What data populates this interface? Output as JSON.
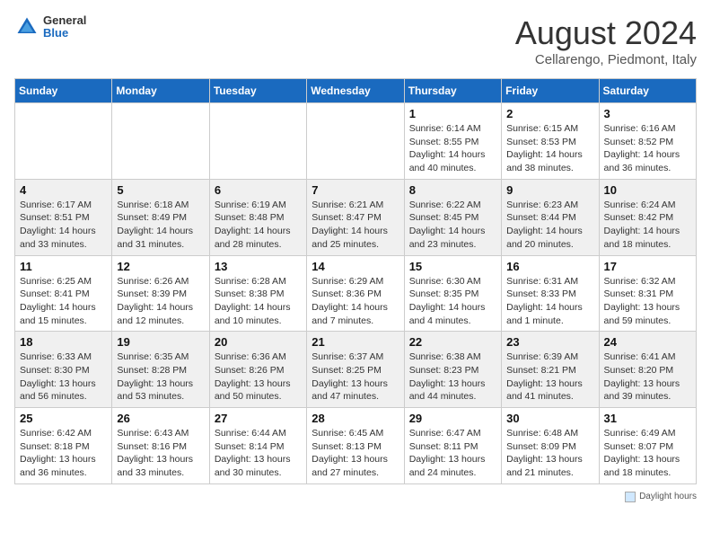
{
  "header": {
    "logo_general": "General",
    "logo_blue": "Blue",
    "month_title": "August 2024",
    "location": "Cellarengo, Piedmont, Italy"
  },
  "weekdays": [
    "Sunday",
    "Monday",
    "Tuesday",
    "Wednesday",
    "Thursday",
    "Friday",
    "Saturday"
  ],
  "weeks": [
    [
      {
        "day": "",
        "info": ""
      },
      {
        "day": "",
        "info": ""
      },
      {
        "day": "",
        "info": ""
      },
      {
        "day": "",
        "info": ""
      },
      {
        "day": "1",
        "info": "Sunrise: 6:14 AM\nSunset: 8:55 PM\nDaylight: 14 hours\nand 40 minutes."
      },
      {
        "day": "2",
        "info": "Sunrise: 6:15 AM\nSunset: 8:53 PM\nDaylight: 14 hours\nand 38 minutes."
      },
      {
        "day": "3",
        "info": "Sunrise: 6:16 AM\nSunset: 8:52 PM\nDaylight: 14 hours\nand 36 minutes."
      }
    ],
    [
      {
        "day": "4",
        "info": "Sunrise: 6:17 AM\nSunset: 8:51 PM\nDaylight: 14 hours\nand 33 minutes."
      },
      {
        "day": "5",
        "info": "Sunrise: 6:18 AM\nSunset: 8:49 PM\nDaylight: 14 hours\nand 31 minutes."
      },
      {
        "day": "6",
        "info": "Sunrise: 6:19 AM\nSunset: 8:48 PM\nDaylight: 14 hours\nand 28 minutes."
      },
      {
        "day": "7",
        "info": "Sunrise: 6:21 AM\nSunset: 8:47 PM\nDaylight: 14 hours\nand 25 minutes."
      },
      {
        "day": "8",
        "info": "Sunrise: 6:22 AM\nSunset: 8:45 PM\nDaylight: 14 hours\nand 23 minutes."
      },
      {
        "day": "9",
        "info": "Sunrise: 6:23 AM\nSunset: 8:44 PM\nDaylight: 14 hours\nand 20 minutes."
      },
      {
        "day": "10",
        "info": "Sunrise: 6:24 AM\nSunset: 8:42 PM\nDaylight: 14 hours\nand 18 minutes."
      }
    ],
    [
      {
        "day": "11",
        "info": "Sunrise: 6:25 AM\nSunset: 8:41 PM\nDaylight: 14 hours\nand 15 minutes."
      },
      {
        "day": "12",
        "info": "Sunrise: 6:26 AM\nSunset: 8:39 PM\nDaylight: 14 hours\nand 12 minutes."
      },
      {
        "day": "13",
        "info": "Sunrise: 6:28 AM\nSunset: 8:38 PM\nDaylight: 14 hours\nand 10 minutes."
      },
      {
        "day": "14",
        "info": "Sunrise: 6:29 AM\nSunset: 8:36 PM\nDaylight: 14 hours\nand 7 minutes."
      },
      {
        "day": "15",
        "info": "Sunrise: 6:30 AM\nSunset: 8:35 PM\nDaylight: 14 hours\nand 4 minutes."
      },
      {
        "day": "16",
        "info": "Sunrise: 6:31 AM\nSunset: 8:33 PM\nDaylight: 14 hours\nand 1 minute."
      },
      {
        "day": "17",
        "info": "Sunrise: 6:32 AM\nSunset: 8:31 PM\nDaylight: 13 hours\nand 59 minutes."
      }
    ],
    [
      {
        "day": "18",
        "info": "Sunrise: 6:33 AM\nSunset: 8:30 PM\nDaylight: 13 hours\nand 56 minutes."
      },
      {
        "day": "19",
        "info": "Sunrise: 6:35 AM\nSunset: 8:28 PM\nDaylight: 13 hours\nand 53 minutes."
      },
      {
        "day": "20",
        "info": "Sunrise: 6:36 AM\nSunset: 8:26 PM\nDaylight: 13 hours\nand 50 minutes."
      },
      {
        "day": "21",
        "info": "Sunrise: 6:37 AM\nSunset: 8:25 PM\nDaylight: 13 hours\nand 47 minutes."
      },
      {
        "day": "22",
        "info": "Sunrise: 6:38 AM\nSunset: 8:23 PM\nDaylight: 13 hours\nand 44 minutes."
      },
      {
        "day": "23",
        "info": "Sunrise: 6:39 AM\nSunset: 8:21 PM\nDaylight: 13 hours\nand 41 minutes."
      },
      {
        "day": "24",
        "info": "Sunrise: 6:41 AM\nSunset: 8:20 PM\nDaylight: 13 hours\nand 39 minutes."
      }
    ],
    [
      {
        "day": "25",
        "info": "Sunrise: 6:42 AM\nSunset: 8:18 PM\nDaylight: 13 hours\nand 36 minutes."
      },
      {
        "day": "26",
        "info": "Sunrise: 6:43 AM\nSunset: 8:16 PM\nDaylight: 13 hours\nand 33 minutes."
      },
      {
        "day": "27",
        "info": "Sunrise: 6:44 AM\nSunset: 8:14 PM\nDaylight: 13 hours\nand 30 minutes."
      },
      {
        "day": "28",
        "info": "Sunrise: 6:45 AM\nSunset: 8:13 PM\nDaylight: 13 hours\nand 27 minutes."
      },
      {
        "day": "29",
        "info": "Sunrise: 6:47 AM\nSunset: 8:11 PM\nDaylight: 13 hours\nand 24 minutes."
      },
      {
        "day": "30",
        "info": "Sunrise: 6:48 AM\nSunset: 8:09 PM\nDaylight: 13 hours\nand 21 minutes."
      },
      {
        "day": "31",
        "info": "Sunrise: 6:49 AM\nSunset: 8:07 PM\nDaylight: 13 hours\nand 18 minutes."
      }
    ]
  ],
  "footer": {
    "daylight_label": "Daylight hours"
  }
}
